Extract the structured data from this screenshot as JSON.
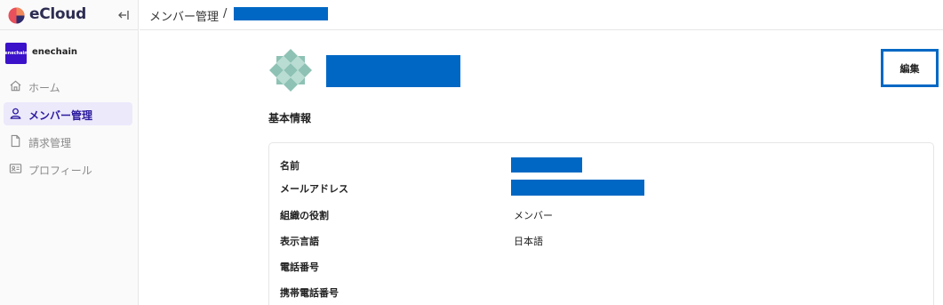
{
  "brand": {
    "name": "eCloud",
    "logo_icon": "ecloud-logo-icon",
    "collapse_icon": "collapse-sidebar-icon"
  },
  "org": {
    "avatar_text": "enechain",
    "name": "enechain"
  },
  "sidebar": {
    "items": [
      {
        "label": "ホーム",
        "icon": "home-icon",
        "active": false
      },
      {
        "label": "メンバー管理",
        "icon": "user-icon",
        "active": true
      },
      {
        "label": "請求管理",
        "icon": "document-icon",
        "active": false
      },
      {
        "label": "プロフィール",
        "icon": "id-card-icon",
        "active": false
      }
    ]
  },
  "header": {
    "breadcrumb_parent": "メンバー管理",
    "separator": "/"
  },
  "profile": {
    "edit_label": "編集"
  },
  "basic_info": {
    "title": "基本情報",
    "fields": [
      {
        "label": "名前",
        "value": ""
      },
      {
        "label": "メールアドレス",
        "value": ""
      },
      {
        "label": "組織の役割",
        "value": "メンバー"
      },
      {
        "label": "表示言語",
        "value": "日本語"
      },
      {
        "label": "電話番号",
        "value": ""
      },
      {
        "label": "携帯電話番号",
        "value": ""
      }
    ]
  },
  "colors": {
    "accent": "#3b12c9",
    "redaction": "#0068c4",
    "active_bg": "#ece9fb"
  }
}
